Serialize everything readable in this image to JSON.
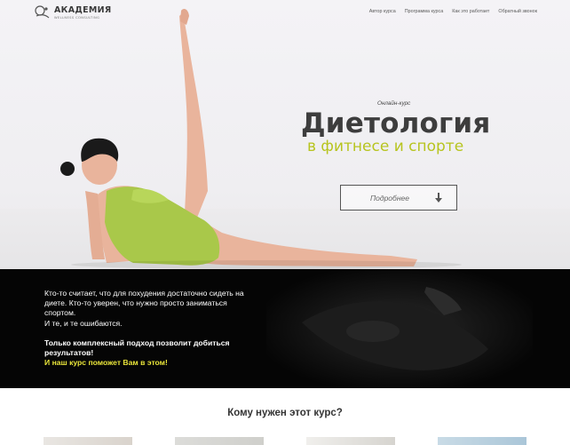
{
  "logo": {
    "title": "АКАДЕМИЯ",
    "subtitle": "WELLNESS CONSULTING"
  },
  "nav": {
    "items": [
      "Автор курса",
      "Программа курса",
      "Как это работает",
      "Обратный звонок"
    ]
  },
  "hero": {
    "kicker": "Онлайн-курс",
    "title": "Диетология",
    "subtitle": "в фитнесе и спорте",
    "button_label": "Подробнее"
  },
  "intro": {
    "lines": [
      "Кто-то считает, что для похудения достаточно сидеть на",
      "диете. Кто-то уверен, что нужно просто заниматься",
      "спортом.",
      "И те, и те ошибаются."
    ],
    "bold_lines": [
      "Только комплексный подход позволит добиться",
      "результатов!"
    ],
    "highlight": "И наш курс поможет Вам в этом!"
  },
  "section2": {
    "title": "Кому нужен этот курс?"
  },
  "colors": {
    "accent": "#b7c41f",
    "highlight": "#e8e43a",
    "dark": "#050505"
  }
}
